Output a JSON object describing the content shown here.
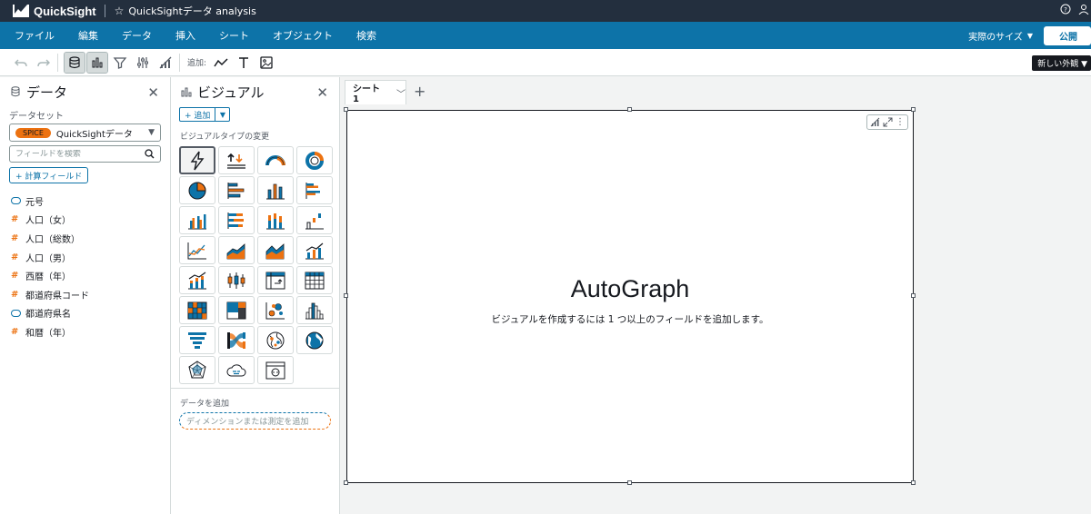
{
  "app": {
    "name": "QuickSight",
    "analysis_title": "QuickSightデータ analysis"
  },
  "menu": {
    "items": [
      "ファイル",
      "編集",
      "データ",
      "挿入",
      "シート",
      "オブジェクト",
      "検索"
    ],
    "size_select": "実際のサイズ",
    "publish": "公開"
  },
  "toolbar": {
    "add_label": "追加:",
    "new_window_tooltip": "新しい外観"
  },
  "data_panel": {
    "title": "データ",
    "dataset_label": "データセット",
    "dataset_badge": "SPICE",
    "dataset_name": "QuickSightデータ",
    "search_placeholder": "フィールドを検索",
    "calc_field_button": "+ 計算フィールド",
    "fields": [
      {
        "name": "元号",
        "type": "dimension"
      },
      {
        "name": "人口（女）",
        "type": "measure"
      },
      {
        "name": "人口（総数）",
        "type": "measure"
      },
      {
        "name": "人口（男）",
        "type": "measure"
      },
      {
        "name": "西暦（年）",
        "type": "measure"
      },
      {
        "name": "都道府県コード",
        "type": "measure"
      },
      {
        "name": "都道府県名",
        "type": "dimension"
      },
      {
        "name": "和暦（年）",
        "type": "measure"
      }
    ]
  },
  "visual_panel": {
    "title": "ビジュアル",
    "add_button": "+ 追加",
    "visual_type_label": "ビジュアルタイプの変更",
    "visual_types": [
      "autograph-icon",
      "kpi-icon",
      "gauge-icon",
      "donut-icon",
      "pie-icon",
      "horizontal-bar-icon",
      "vertical-bar-icon",
      "clustered-horizontal-bar-icon",
      "clustered-vertical-bar-icon",
      "stacked-horizontal-bar-icon",
      "stacked-vertical-bar-icon",
      "waterfall-icon",
      "line-icon",
      "area-line-icon",
      "stacked-area-icon",
      "combo-bar-line-icon",
      "combo-stacked-icon",
      "box-plot-icon",
      "pivot-table-icon",
      "table-icon",
      "heatmap-icon",
      "treemap-icon",
      "scatter-icon",
      "histogram-icon",
      "funnel-icon",
      "sankey-icon",
      "points-map-icon",
      "filled-map-icon",
      "radar-icon",
      "word-cloud-icon",
      "custom-visual-icon"
    ],
    "add_data_label": "データを追加",
    "dimension_drop_placeholder": "ディメンションまたは測定を追加"
  },
  "sheet": {
    "tab_name": "シート 1"
  },
  "visual": {
    "title": "AutoGraph",
    "message": "ビジュアルを作成するには 1 つ以上のフィールドを追加します。"
  }
}
